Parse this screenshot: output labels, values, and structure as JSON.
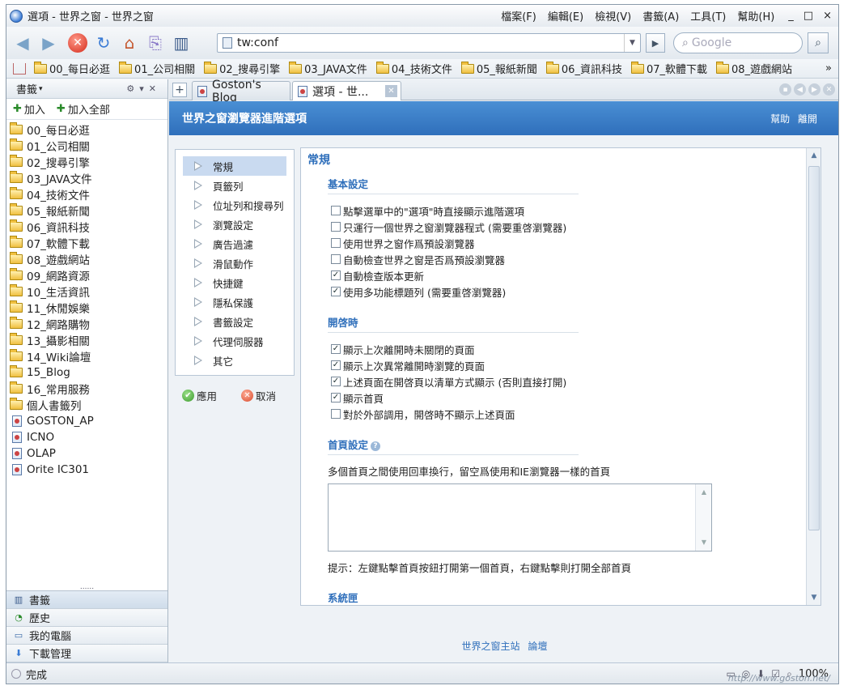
{
  "window": {
    "title": "選項 - 世界之窗 - 世界之窗",
    "menu": [
      "檔案(F)",
      "編輯(E)",
      "檢視(V)",
      "書籤(A)",
      "工具(T)",
      "幫助(H)"
    ],
    "controls": [
      "_",
      "□",
      "×"
    ]
  },
  "nav": {
    "url": "tw:conf",
    "search_placeholder": "Google"
  },
  "favorites": {
    "items": [
      "00_每日必逛",
      "01_公司相關",
      "02_搜尋引擎",
      "03_JAVA文件",
      "04_技術文件",
      "05_報紙新聞",
      "06_資訊科技",
      "07_軟體下載",
      "08_遊戲網站"
    ],
    "more": "»"
  },
  "sidebar": {
    "title": "書籤",
    "add": "加入",
    "add_all": "加入全部",
    "folders": [
      "00_每日必逛",
      "01_公司相關",
      "02_搜尋引擎",
      "03_JAVA文件",
      "04_技術文件",
      "05_報紙新聞",
      "06_資訊科技",
      "07_軟體下載",
      "08_遊戲網站",
      "09_網路資源",
      "10_生活資訊",
      "11_休閒娛樂",
      "12_網路購物",
      "13_攝影相關",
      "14_Wiki論壇",
      "15_Blog",
      "16_常用服務",
      "個人書籤列"
    ],
    "pages": [
      "GOSTON_AP",
      "ICNO",
      "OLAP",
      "Orite IC301"
    ],
    "grip": "......",
    "tabs": [
      "書籤",
      "歷史",
      "我的電腦",
      "下載管理"
    ]
  },
  "tabs": [
    {
      "label": "Goston's Blog"
    },
    {
      "label": "選項 - 世..."
    }
  ],
  "page": {
    "header_title": "世界之窗瀏覽器進階選項",
    "help": "幫助",
    "leave": "離開",
    "nav": [
      "常規",
      "頁籤列",
      "位址列和搜尋列",
      "瀏覽設定",
      "廣告過濾",
      "滑鼠動作",
      "快捷鍵",
      "隱私保護",
      "書籤設定",
      "代理伺服器",
      "其它"
    ],
    "apply": "應用",
    "cancel": "取消",
    "section_title": "常規",
    "basic": {
      "title": "基本設定",
      "options": [
        {
          "label": "點擊選單中的\"選項\"時直接顯示進階選項",
          "checked": false
        },
        {
          "label": "只運行一個世界之窗瀏覽器程式 (需要重啓瀏覽器)",
          "checked": false
        },
        {
          "label": "使用世界之窗作爲預設瀏覽器",
          "checked": false
        },
        {
          "label": "自動檢查世界之窗是否爲預設瀏覽器",
          "checked": false
        },
        {
          "label": "自動檢查版本更新",
          "checked": true
        },
        {
          "label": "使用多功能標題列 (需要重啓瀏覽器)",
          "checked": true
        }
      ]
    },
    "startup": {
      "title": "開啓時",
      "options": [
        {
          "label": "顯示上次離開時未關閉的頁面",
          "checked": true
        },
        {
          "label": "顯示上次異常離開時瀏覽的頁面",
          "checked": true
        },
        {
          "label": "上述頁面在開啓頁以清單方式顯示 (否則直接打開)",
          "checked": true
        },
        {
          "label": "顯示首頁",
          "checked": true
        },
        {
          "label": "對於外部調用，開啓時不顯示上述頁面",
          "checked": false
        }
      ]
    },
    "home": {
      "title": "首頁設定",
      "help_icon": "?",
      "desc": "多個首頁之間使用回車換行，留空爲使用和IE瀏覽器一樣的首頁",
      "value": "",
      "tip": "提示：左鍵點擊首頁按鈕打開第一個首頁，右鍵點擊則打開全部首頁"
    },
    "tray": {
      "title": "系統匣"
    },
    "footer": [
      "世界之窗主站",
      "論壇"
    ]
  },
  "status": {
    "text": "完成",
    "zoom": "100%",
    "watermark": "http://www.goston.net/"
  }
}
